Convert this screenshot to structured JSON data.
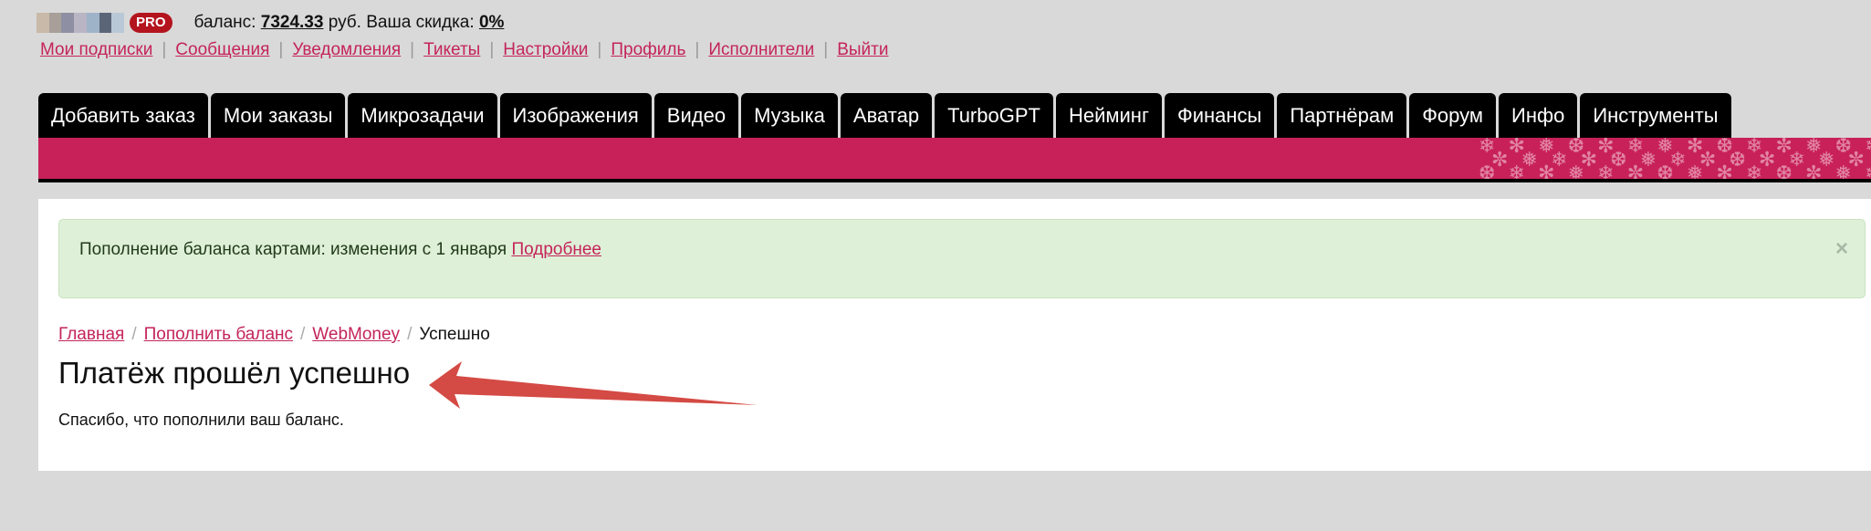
{
  "user": {
    "badge": "PRO",
    "balance_label": "баланс:",
    "balance_value": "7324.33",
    "currency": "руб.",
    "discount_label": "Ваша скидка:",
    "discount_value": "0%",
    "avatar_colors": [
      "#c9b9a8",
      "#a89f9a",
      "#8e8fa2",
      "#b9b5c4",
      "#9fb3c8",
      "#5a6678",
      "#b8c8d6"
    ]
  },
  "userlinks": [
    "Мои подписки",
    "Сообщения",
    "Уведомления",
    "Тикеты",
    "Настройки",
    "Профиль",
    "Исполнители",
    "Выйти"
  ],
  "menu": [
    "Добавить заказ",
    "Мои заказы",
    "Микрозадачи",
    "Изображения",
    "Видео",
    "Музыка",
    "Аватар",
    "TurboGPT",
    "Нейминг",
    "Финансы",
    "Партнёрам",
    "Форум",
    "Инфо",
    "Инструменты"
  ],
  "alert": {
    "text": "Пополнение баланса картами: изменения с 1 января",
    "link": "Подробнее",
    "close": "×"
  },
  "breadcrumb": [
    "Главная",
    "Пополнить баланс",
    "WebMoney"
  ],
  "breadcrumb_current": "Успешно",
  "page": {
    "title": "Платёж прошёл успешно",
    "text": "Спасибо, что пополнили ваш баланс."
  },
  "colors": {
    "accent": "#c4245a",
    "banner": "#c8215a",
    "menu_bg": "#000000",
    "alert_bg": "#dff0d8",
    "arrow": "#d44a44",
    "badge": "#b4141e"
  }
}
